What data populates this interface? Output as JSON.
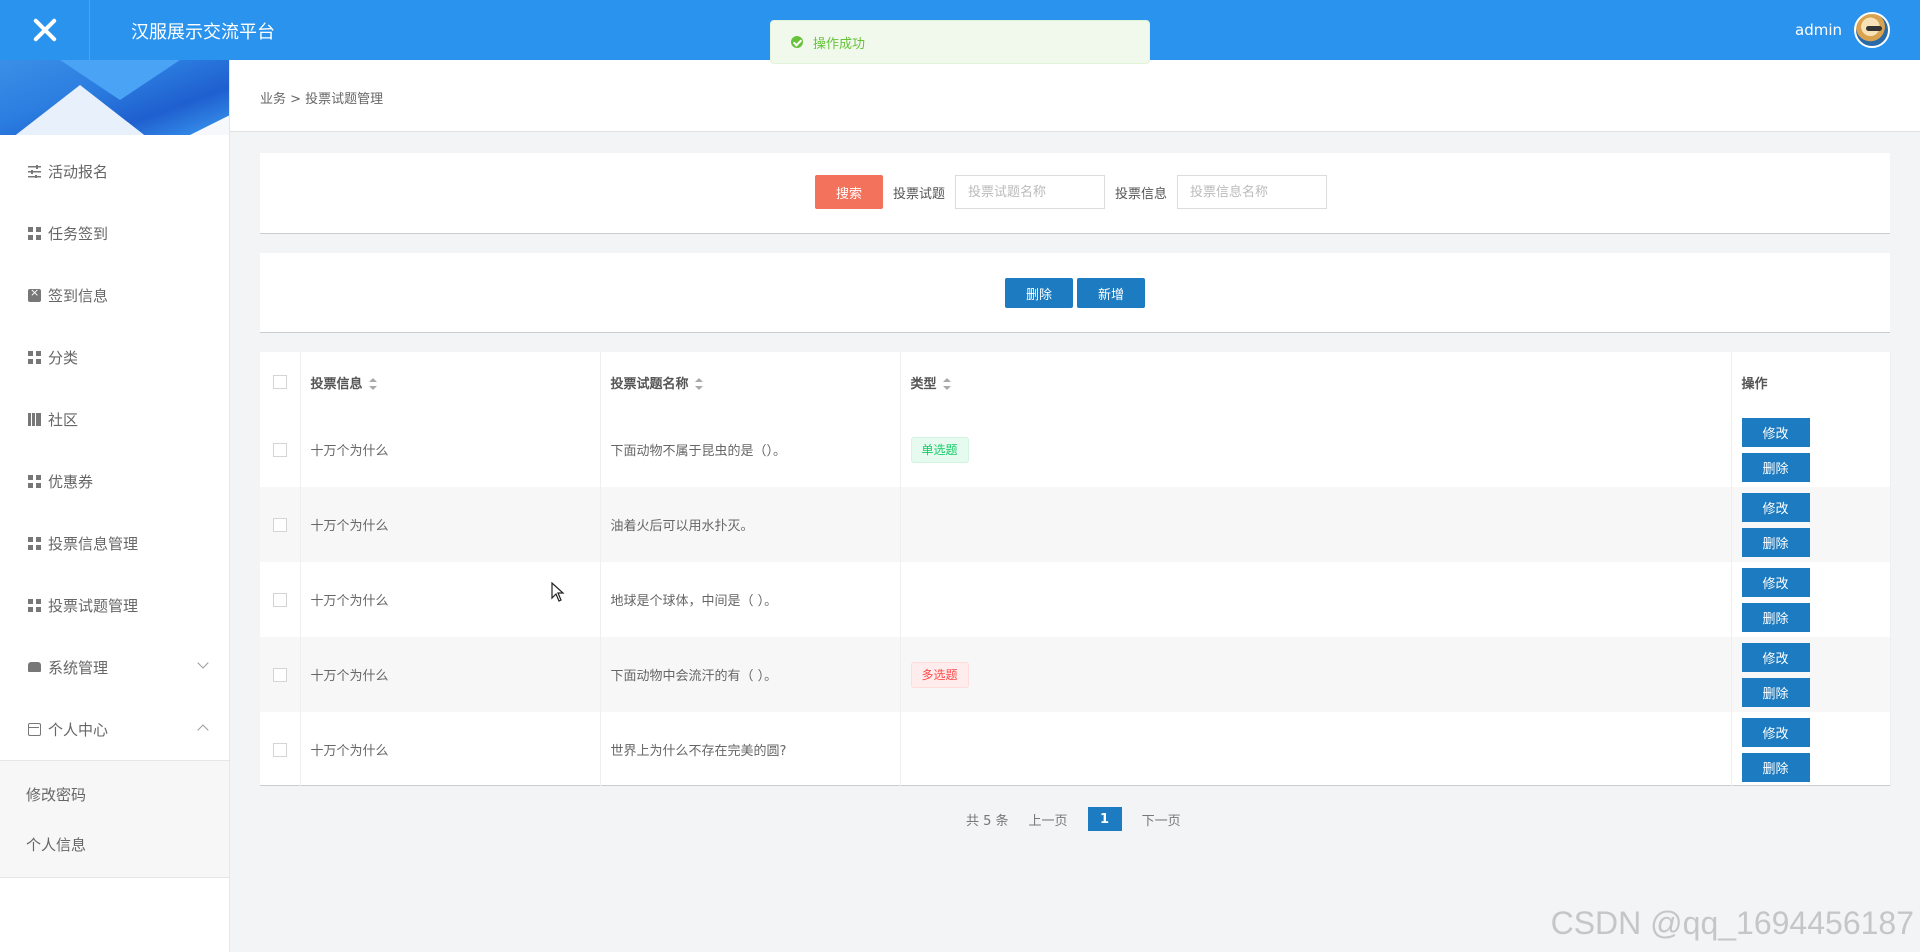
{
  "app": {
    "title": "汉服展示交流平台",
    "user": "admin"
  },
  "toast": {
    "message": "操作成功"
  },
  "sidebar": {
    "items": [
      {
        "label": "活动报名",
        "icon": "sliders-icon"
      },
      {
        "label": "任务签到",
        "icon": "grid-icon"
      },
      {
        "label": "签到信息",
        "icon": "clipboard-icon"
      },
      {
        "label": "分类",
        "icon": "grid-icon"
      },
      {
        "label": "社区",
        "icon": "book-icon"
      },
      {
        "label": "优惠券",
        "icon": "grid-icon"
      },
      {
        "label": "投票信息管理",
        "icon": "grid-icon"
      },
      {
        "label": "投票试题管理",
        "icon": "grid-icon"
      },
      {
        "label": "系统管理",
        "icon": "monitor-icon",
        "expanded": false
      },
      {
        "label": "个人中心",
        "icon": "card-icon",
        "expanded": true
      }
    ],
    "submenu": [
      "修改密码",
      "个人信息"
    ]
  },
  "breadcrumb": {
    "text": "业务 > 投票试题管理"
  },
  "search": {
    "button": "搜索",
    "field1_label": "投票试题",
    "field1_placeholder": "投票试题名称",
    "field2_label": "投票信息",
    "field2_placeholder": "投票信息名称"
  },
  "actions": {
    "delete": "删除",
    "add": "新增"
  },
  "table": {
    "headers": [
      "投票信息",
      "投票试题名称",
      "类型",
      "操作"
    ],
    "rows": [
      {
        "info": "十万个为什么",
        "question": "下面动物不属于昆虫的是（）。",
        "type": "单选题",
        "type_style": "single"
      },
      {
        "info": "十万个为什么",
        "question": "油着火后可以用水扑灭。",
        "type": "",
        "type_style": ""
      },
      {
        "info": "十万个为什么",
        "question": "地球是个球体，中间是（ ）。",
        "type": "",
        "type_style": ""
      },
      {
        "info": "十万个为什么",
        "question": "下面动物中会流汗的有（ ）。",
        "type": "多选题",
        "type_style": "multi"
      },
      {
        "info": "十万个为什么",
        "question": "世界上为什么不存在完美的圆?",
        "type": "",
        "type_style": ""
      }
    ],
    "row_buttons": {
      "edit": "修改",
      "delete": "删除"
    }
  },
  "pagination": {
    "total": "共 5 条",
    "prev": "上一页",
    "current": "1",
    "next": "下一页"
  },
  "watermark": "CSDN @qq_1694456187",
  "colors": {
    "topbar": "#2a93ee",
    "primary_button": "#1d7bc1",
    "search_button": "#f2725c",
    "toast_green": "#67c23a"
  }
}
